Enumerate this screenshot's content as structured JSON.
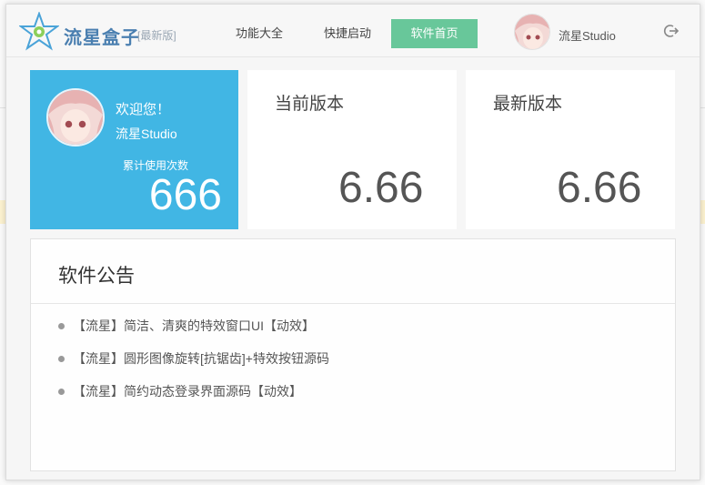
{
  "app": {
    "brand": "流星盒子",
    "brand_tag": "[最新版]"
  },
  "nav": {
    "features": "功能大全",
    "quick_launch": "快捷启动",
    "home": "软件首页"
  },
  "user": {
    "name": "流星Studio",
    "welcome": "欢迎您！",
    "usage_label": "累计使用次数",
    "usage_count": "666"
  },
  "versions": {
    "current_label": "当前版本",
    "current_value": "6.66",
    "latest_label": "最新版本",
    "latest_value": "6.66"
  },
  "notice": {
    "title": "软件公告",
    "items": [
      "【流星】简洁、清爽的特效窗口UI【动效】",
      "【流星】圆形图像旋转[抗锯齿]+特效按钮源码",
      "【流星】简约动态登录界面源码【动效】"
    ]
  },
  "colors": {
    "accent": "#41b6e4",
    "nav_active": "#68c79a"
  }
}
